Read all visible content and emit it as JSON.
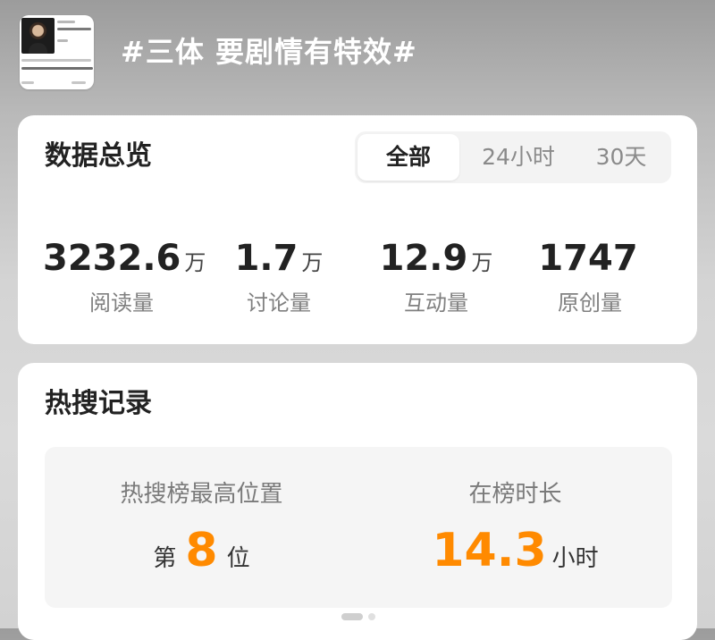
{
  "header": {
    "thumbnail_icon": "post-thumbnail",
    "title": "#三体 要剧情有特效#"
  },
  "overview": {
    "title": "数据总览",
    "tabs": [
      {
        "label": "全部",
        "active": true
      },
      {
        "label": "24小时",
        "active": false
      },
      {
        "label": "30天",
        "active": false
      }
    ],
    "stats": [
      {
        "value": "3232.6",
        "unit": "万",
        "label": "阅读量"
      },
      {
        "value": "1.7",
        "unit": "万",
        "label": "讨论量"
      },
      {
        "value": "12.9",
        "unit": "万",
        "label": "互动量"
      },
      {
        "value": "1747",
        "unit": "",
        "label": "原创量"
      }
    ]
  },
  "hot_search": {
    "title": "热搜记录",
    "rank": {
      "label": "热搜榜最高位置",
      "prefix": "第",
      "value": "8",
      "suffix": "位"
    },
    "duration": {
      "label": "在榜时长",
      "value": "14.3",
      "unit": "小时"
    }
  },
  "colors": {
    "accent": "#ff8a00",
    "card": "#ffffff",
    "panel": "#f5f5f5"
  },
  "pager": {
    "total": 2,
    "current": 1
  }
}
